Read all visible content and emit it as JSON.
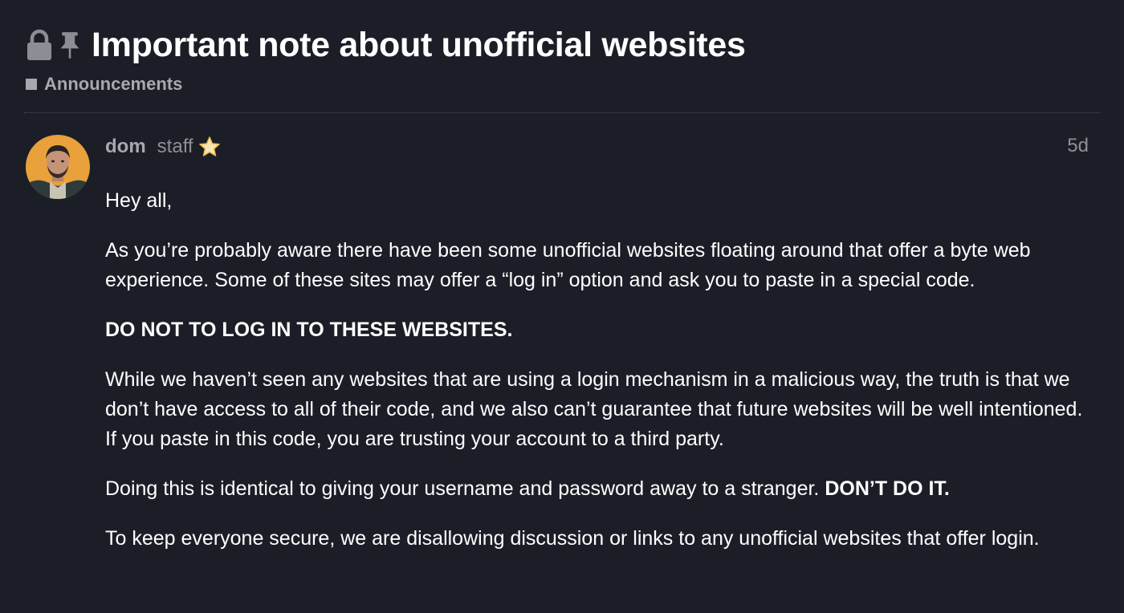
{
  "topic": {
    "title": "Important note about unofficial websites",
    "icons": [
      "lock-icon",
      "pin-icon"
    ],
    "category": {
      "label": "Announcements",
      "color": "#a8a9ae"
    }
  },
  "post": {
    "author": {
      "username": "dom",
      "title": "staff",
      "badge_icon": "star-icon",
      "avatar_bg": "#e8a13b"
    },
    "date": "5d",
    "paragraphs": {
      "greeting": "Hey all,",
      "intro": "As you’re probably aware there have been some unofficial websites floating around that offer a byte web experience. Some of these sites may offer a “log in” option and ask you to paste in a special code.",
      "warning": "DO NOT TO LOG IN TO THESE WEBSITES.",
      "explanation": "While we haven’t seen any websites that are using a login mechanism in a malicious way, the truth is that we don’t have access to all of their code, and we also can’t guarantee that future websites will be well intentioned. If you paste in this code, you are trusting your account to a third party.",
      "comparison_text": "Doing this is identical to giving your username and password away to a stranger.",
      "comparison_emphasis": "DON’T DO IT.",
      "policy": "To keep everyone secure, we are disallowing discussion or links to any unofficial websites that offer login."
    }
  },
  "colors": {
    "background": "#1c1e27",
    "text_primary": "#ffffff",
    "text_muted": "#a8a9ae"
  }
}
